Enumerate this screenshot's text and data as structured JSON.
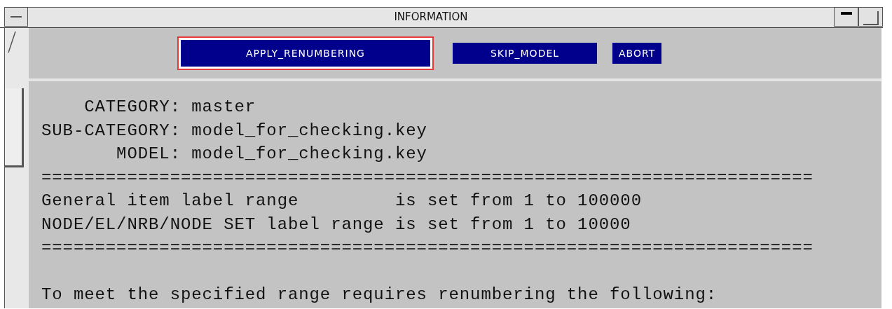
{
  "window": {
    "title": "INFORMATION"
  },
  "buttons": [
    {
      "label": "APPLY_RENUMBERING",
      "focused": true
    },
    {
      "label": "SKIP_MODEL",
      "focused": false
    },
    {
      "label": "ABORT",
      "focused": false
    }
  ],
  "text_groups": [
    {
      "lines": [
        "    CATEGORY: master",
        "SUB-CATEGORY: model_for_checking.key",
        "       MODEL: model_for_checking.key",
        "========================================================================",
        "General item label range         is set from 1 to 100000",
        "NODE/EL/NRB/NODE SET label range is set from 1 to 10000",
        "========================================================================"
      ]
    },
    {
      "lines": [
        "To meet the specified range requires renumbering the following:"
      ]
    }
  ]
}
